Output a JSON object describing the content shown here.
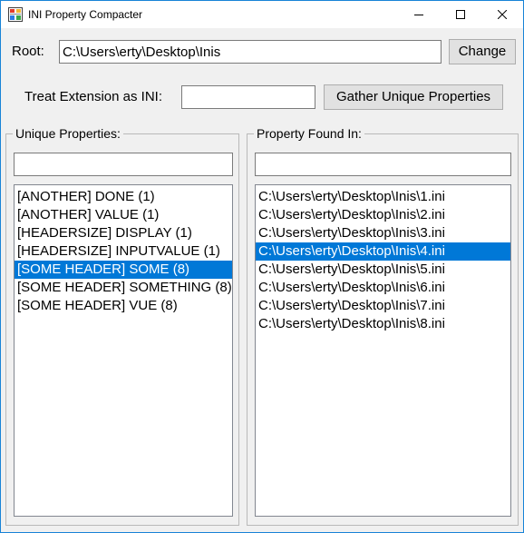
{
  "window": {
    "title": "INI Property Compacter",
    "icon": "app-icon"
  },
  "root": {
    "label": "Root:",
    "value": "C:\\Users\\erty\\Desktop\\Inis",
    "change_label": "Change"
  },
  "extension": {
    "label": "Treat Extension as INI:",
    "value": "",
    "gather_label": "Gather Unique Properties"
  },
  "unique_properties": {
    "title": "Unique Properties:",
    "filter_value": "",
    "items": [
      {
        "text": "[ANOTHER] DONE (1)",
        "selected": false
      },
      {
        "text": "[ANOTHER] VALUE (1)",
        "selected": false
      },
      {
        "text": "[HEADERSIZE] DISPLAY (1)",
        "selected": false
      },
      {
        "text": "[HEADERSIZE] INPUTVALUE (1)",
        "selected": false
      },
      {
        "text": "[SOME HEADER] SOME (8)",
        "selected": true
      },
      {
        "text": "[SOME HEADER] SOMETHING (8)",
        "selected": false
      },
      {
        "text": "[SOME HEADER] VUE (8)",
        "selected": false
      }
    ]
  },
  "property_found_in": {
    "title": "Property Found In:",
    "filter_value": "",
    "items": [
      {
        "text": "C:\\Users\\erty\\Desktop\\Inis\\1.ini",
        "selected": false
      },
      {
        "text": "C:\\Users\\erty\\Desktop\\Inis\\2.ini",
        "selected": false
      },
      {
        "text": "C:\\Users\\erty\\Desktop\\Inis\\3.ini",
        "selected": false
      },
      {
        "text": "C:\\Users\\erty\\Desktop\\Inis\\4.ini",
        "selected": true
      },
      {
        "text": "C:\\Users\\erty\\Desktop\\Inis\\5.ini",
        "selected": false
      },
      {
        "text": "C:\\Users\\erty\\Desktop\\Inis\\6.ini",
        "selected": false
      },
      {
        "text": "C:\\Users\\erty\\Desktop\\Inis\\7.ini",
        "selected": false
      },
      {
        "text": "C:\\Users\\erty\\Desktop\\Inis\\8.ini",
        "selected": false
      }
    ]
  },
  "colors": {
    "selection": "#0078d7",
    "window_border": "#1883d7",
    "background": "#f0f0f0"
  }
}
